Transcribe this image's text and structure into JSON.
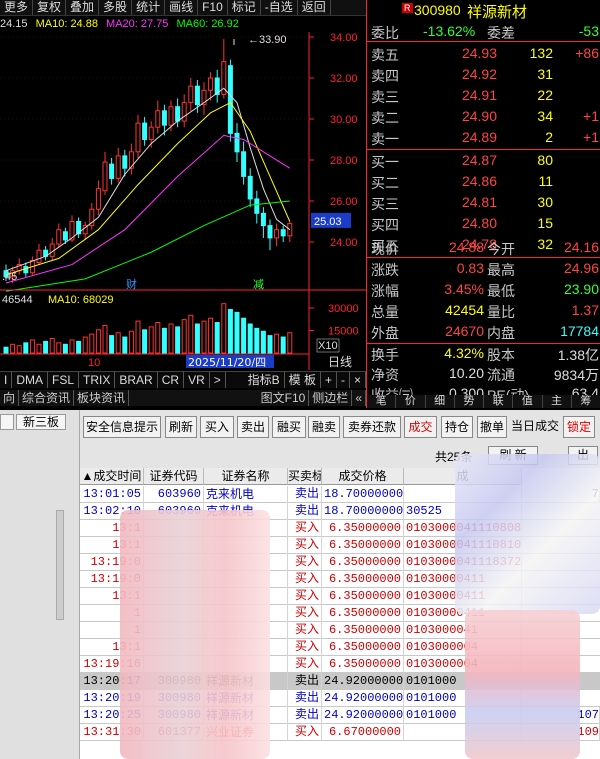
{
  "menubar": {
    "items": [
      "更多",
      "复权",
      "叠加",
      "多股",
      "统计",
      "画线",
      "F10",
      "标记",
      "-自选",
      "返回"
    ]
  },
  "ma_line": {
    "ma5": "24.15",
    "ma10": "MA10: 24.88",
    "ma20": "MA20: 27.75",
    "ma60": "MA60: 26.92"
  },
  "price_axis": [
    "34.00",
    "32.00",
    "30.00",
    "28.00",
    "26.00",
    "24.00"
  ],
  "chart_labels": {
    "high": "33.90",
    "cur_price": "25.03",
    "low_left": ".45",
    "marker_cai": "财",
    "marker_jian": "减"
  },
  "volume": {
    "header_vol": "46544",
    "header_ma10": "MA10: 68029",
    "axis": [
      "30000",
      "15000"
    ],
    "unit": "X10",
    "month_tick": "10",
    "date_tick": "2025/11/20/四",
    "period": "日线"
  },
  "toolbar": {
    "items": [
      "I",
      "DMA",
      "FSL",
      "TRIX",
      "BRAR",
      "CR",
      "VR",
      ">"
    ],
    "index_label": "指标B",
    "template_label": "模 板",
    "plus": "+",
    "minus": "-",
    "close": "×"
  },
  "tabbar": {
    "items": [
      "向",
      "综合资讯",
      "板块资讯"
    ],
    "right": "图文F10",
    "right2": "侧边栏",
    "arrows": "«"
  },
  "quote": {
    "code_badge": "R",
    "code": "300980",
    "name": "祥源新材",
    "weibi_label": "委比",
    "weibi": "-13.62%",
    "weicha_label": "委差",
    "weicha": "-53",
    "sells": [
      {
        "label": "卖五",
        "price": "24.93",
        "vol": "132",
        "chg": "+86"
      },
      {
        "label": "卖四",
        "price": "24.92",
        "vol": "31",
        "chg": ""
      },
      {
        "label": "卖三",
        "price": "24.91",
        "vol": "22",
        "chg": ""
      },
      {
        "label": "卖二",
        "price": "24.90",
        "vol": "34",
        "chg": "+1"
      },
      {
        "label": "卖一",
        "price": "24.89",
        "vol": "2",
        "chg": "+1"
      }
    ],
    "buys": [
      {
        "label": "买一",
        "price": "24.87",
        "vol": "80",
        "chg": ""
      },
      {
        "label": "买二",
        "price": "24.86",
        "vol": "11",
        "chg": ""
      },
      {
        "label": "买三",
        "price": "24.81",
        "vol": "30",
        "chg": ""
      },
      {
        "label": "买四",
        "price": "24.80",
        "vol": "15",
        "chg": ""
      },
      {
        "label": "买五",
        "price": "24.78",
        "vol": "32",
        "chg": ""
      }
    ],
    "stats": [
      {
        "l1": "现价",
        "v1": "24.88",
        "l2": "今开",
        "v2": "24.16"
      },
      {
        "l1": "涨跌",
        "v1": "0.83",
        "l2": "最高",
        "v2": "24.96"
      },
      {
        "l1": "涨幅",
        "v1": "3.45%",
        "l2": "最低",
        "v2": "23.90"
      },
      {
        "l1": "总量",
        "v1": "42454",
        "l2": "量比",
        "v2": "1.37"
      },
      {
        "l1": "外盘",
        "v1": "24670",
        "l2": "内盘",
        "v2": "17784"
      }
    ],
    "stats2": [
      {
        "l1": "换手",
        "v1": "4.32%",
        "l2": "股本",
        "v2": "1.38亿"
      },
      {
        "l1": "净资",
        "v1": "10.20",
        "l2": "流通",
        "v2": "9834万"
      },
      {
        "l1": "收益㈢",
        "v1": "0.300",
        "l2": "PE(动)",
        "v2": "63.4"
      }
    ],
    "bottom_tabs": [
      "笔",
      "价",
      "细",
      "势",
      "联",
      "值",
      "主",
      "筹"
    ]
  },
  "trade_panel": {
    "left_tabs": [
      "新三板"
    ],
    "buttons": [
      "安全信息提示",
      "刷新",
      "买入",
      "卖出",
      "融买",
      "融卖",
      "卖券还款",
      "成交",
      "持仓",
      "撤单",
      "当日成交",
      "锁定"
    ],
    "count": "共25条",
    "refresh": "刷 新",
    "output": "出",
    "columns": [
      "成交时间",
      "证券代码",
      "证券名称",
      "买卖标志",
      "成交价格",
      "成"
    ],
    "rows": [
      {
        "time": "13:01:05",
        "code": "603960",
        "name": "克来机电",
        "side": "卖出",
        "price": "18.70000000",
        "no": "",
        "tail": "7"
      },
      {
        "time": "13:02:10",
        "code": "603960",
        "name": "克来机电",
        "side": "卖出",
        "price": "18.70000000",
        "no": "30525",
        "tail": ""
      },
      {
        "time": "13:1",
        "code": "",
        "name": "",
        "side": "买入",
        "price": "6.35000000",
        "no": "0103000041110808",
        "tail": ""
      },
      {
        "time": "13:1",
        "code": "",
        "name": "",
        "side": "买入",
        "price": "6.35000000",
        "no": "0103000041110810",
        "tail": ""
      },
      {
        "time": "13:19:0",
        "code": "",
        "name": "",
        "side": "买入",
        "price": "6.35000000",
        "no": "0103000041118372",
        "tail": ""
      },
      {
        "time": "13:19:0",
        "code": "",
        "name": "",
        "side": "买入",
        "price": "6.35000000",
        "no": "01030000411",
        "tail": ""
      },
      {
        "time": "13:1",
        "code": "",
        "name": "",
        "side": "买入",
        "price": "6.35000000",
        "no": "01030000411",
        "tail": ""
      },
      {
        "time": "1",
        "code": "",
        "name": "",
        "side": "买入",
        "price": "6.35000000",
        "no": "01030000411",
        "tail": ""
      },
      {
        "time": "1",
        "code": "",
        "name": "",
        "side": "买入",
        "price": "6.35000000",
        "no": "0103000041",
        "tail": ""
      },
      {
        "time": "13:1",
        "code": "",
        "name": "",
        "side": "买入",
        "price": "6.35000000",
        "no": "0103000004",
        "tail": ""
      },
      {
        "time": "13:19:16",
        "code": "",
        "name": "",
        "side": "买入",
        "price": "6.35000000",
        "no": "0103000004",
        "tail": ""
      },
      {
        "time": "13:20:17",
        "code": "300980",
        "name": "祥源新材",
        "side": "卖出",
        "price": "24.92000000",
        "no": "0101000",
        "tail": ""
      },
      {
        "time": "13:20:19",
        "code": "300980",
        "name": "祥源新材",
        "side": "卖出",
        "price": "24.92000000",
        "no": "0101000",
        "tail": ""
      },
      {
        "time": "13:20:25",
        "code": "300980",
        "name": "祥源新材",
        "side": "卖出",
        "price": "24.92000000",
        "no": "0101000",
        "tail": "107"
      },
      {
        "time": "13:31:30",
        "code": "601377",
        "name": "兴业证券",
        "side": "买入",
        "price": "6.67000000",
        "no": "",
        "tail": "109"
      }
    ]
  },
  "colors": {
    "up": "#ff3333",
    "down": "#33ffff",
    "ma10": "#ffff00",
    "ma20": "#ff33ff",
    "ma60": "#00ff00",
    "buy_text": "#d00000",
    "sell_text": "#0000cc"
  }
}
